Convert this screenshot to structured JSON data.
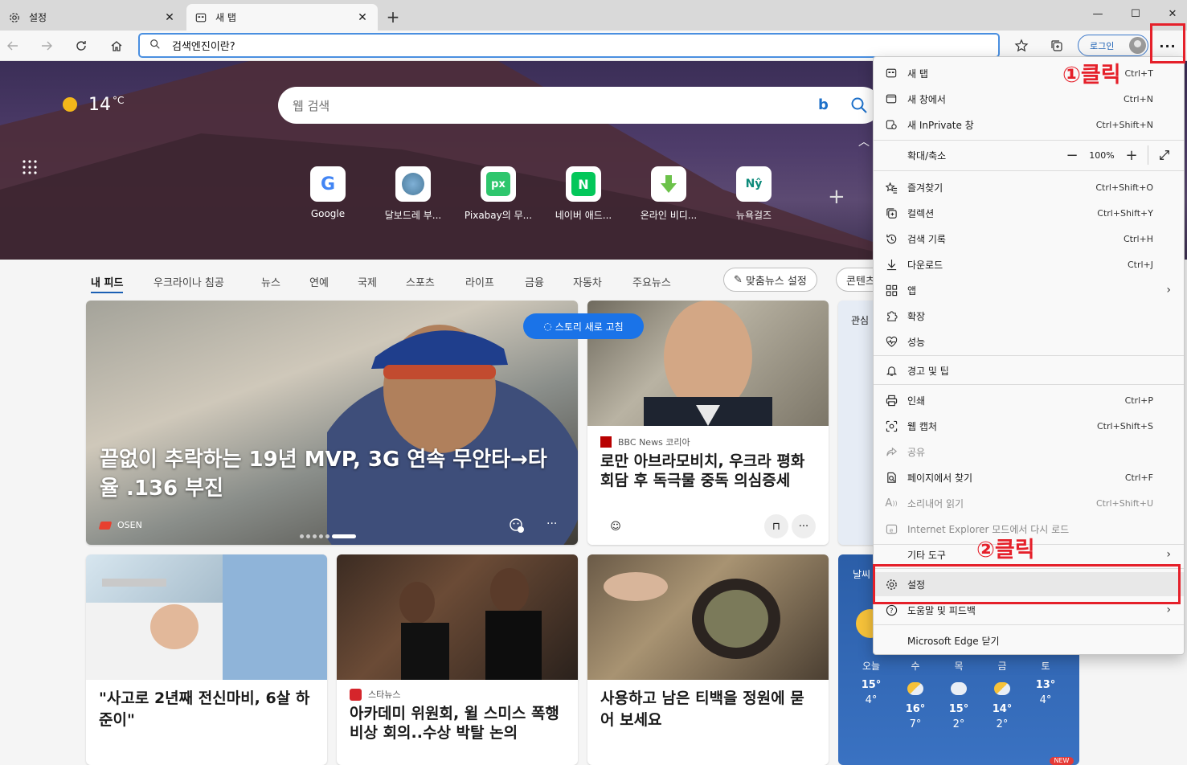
{
  "tabs": [
    {
      "label": "설정",
      "icon": "gear-icon"
    },
    {
      "label": "새 탭",
      "icon": "newtab-page-icon"
    }
  ],
  "address_bar": {
    "value": "검색엔진이란?"
  },
  "toolbar": {
    "login_label": "로그인",
    "more_label": "···"
  },
  "hero": {
    "temperature": "14",
    "temperature_unit": "°C",
    "search_placeholder": "웹 검색",
    "quick_links": [
      {
        "label": "Google",
        "icon": "google-icon"
      },
      {
        "label": "달보드레 부...",
        "icon": "site-avatar-icon"
      },
      {
        "label": "Pixabay의 무...",
        "icon": "pixabay-icon"
      },
      {
        "label": "네이버 애드...",
        "icon": "naver-icon"
      },
      {
        "label": "온라인 비디...",
        "icon": "download-arrow-icon"
      },
      {
        "label": "뉴욕걸즈",
        "icon": "nyg-icon"
      }
    ]
  },
  "feed_nav": {
    "items": [
      "내 피드",
      "우크라이나 침공",
      "뉴스",
      "연예",
      "국제",
      "스포츠",
      "라이프",
      "금융",
      "자동차",
      "주요뉴스"
    ],
    "personalize_label": "맞춤뉴스 설정",
    "content_label": "콘텐츠"
  },
  "cards": {
    "refresh_label": "스토리 새로 고침",
    "big": {
      "headline": "끝없이 추락하는 19년 MVP, 3G 연속 무안타→타율 .136 부진",
      "source": "OSEN"
    },
    "bbc": {
      "source": "BBC News 코리아",
      "title": "로만 아브라모비치, 우크라 평화회담 후 독극물 중독 의심증세"
    },
    "interest": {
      "header": "관심"
    },
    "child": {
      "title": "\"사고로 2년째 전신마비, 6살 하준이\""
    },
    "academy": {
      "source": "스타뉴스",
      "title": "아카데미 위원회, 윌 스미스 폭행 비상 회의..수상 박탈 논의"
    },
    "teabag": {
      "title": "사용하고 남은 티백을 정원에 묻어 보세요"
    }
  },
  "weather": {
    "header": "날씨",
    "days": [
      {
        "day": "오늘",
        "hi": "15°",
        "lo": "4°",
        "icon": "sun"
      },
      {
        "day": "수",
        "hi": "16°",
        "lo": "7°",
        "icon": "ps"
      },
      {
        "day": "목",
        "hi": "15°",
        "lo": "2°",
        "icon": "cloud"
      },
      {
        "day": "금",
        "hi": "14°",
        "lo": "2°",
        "icon": "ps"
      },
      {
        "day": "토",
        "hi": "13°",
        "lo": "4°",
        "icon": "sun"
      }
    ]
  },
  "menu": {
    "items": [
      {
        "label": "새 탭",
        "shortcut": "Ctrl+T",
        "icon": "new-tab-icon"
      },
      {
        "label": "새 창에서",
        "shortcut": "Ctrl+N",
        "icon": "new-window-icon"
      },
      {
        "label": "새 InPrivate 창",
        "shortcut": "Ctrl+Shift+N",
        "icon": "inprivate-icon"
      },
      {
        "label": "즐겨찾기",
        "shortcut": "Ctrl+Shift+O",
        "icon": "favorites-icon"
      },
      {
        "label": "컬렉션",
        "shortcut": "Ctrl+Shift+Y",
        "icon": "collections-icon"
      },
      {
        "label": "검색 기록",
        "shortcut": "Ctrl+H",
        "icon": "history-icon"
      },
      {
        "label": "다운로드",
        "shortcut": "Ctrl+J",
        "icon": "download-icon"
      },
      {
        "label": "앱",
        "shortcut": "",
        "icon": "apps-icon",
        "arrow": true
      },
      {
        "label": "확장",
        "shortcut": "",
        "icon": "extensions-icon"
      },
      {
        "label": "성능",
        "shortcut": "",
        "icon": "performance-icon"
      },
      {
        "label": "경고 및 팁",
        "shortcut": "",
        "icon": "bell-icon"
      },
      {
        "label": "인쇄",
        "shortcut": "Ctrl+P",
        "icon": "print-icon"
      },
      {
        "label": "웹 캡처",
        "shortcut": "Ctrl+Shift+S",
        "icon": "web-capture-icon"
      },
      {
        "label": "공유",
        "shortcut": "",
        "icon": "share-icon",
        "disabled": true
      },
      {
        "label": "페이지에서 찾기",
        "shortcut": "Ctrl+F",
        "icon": "find-icon"
      },
      {
        "label": "소리내어 읽기",
        "shortcut": "Ctrl+Shift+U",
        "icon": "read-aloud-icon",
        "disabled": true
      },
      {
        "label": "Internet Explorer 모드에서 다시 로드",
        "shortcut": "",
        "icon": "ie-mode-icon",
        "disabled": true
      },
      {
        "label": "기타 도구",
        "shortcut": "",
        "icon": "",
        "arrow": true
      },
      {
        "label": "설정",
        "shortcut": "",
        "icon": "gear-icon"
      },
      {
        "label": "도움말 및 피드백",
        "shortcut": "",
        "icon": "help-icon",
        "arrow": true
      },
      {
        "label": "Microsoft Edge 닫기",
        "shortcut": "",
        "icon": ""
      }
    ],
    "zoom": {
      "label": "확대/축소",
      "value": "100%"
    }
  },
  "annotations": {
    "first": "①클릭",
    "second": "②클릭",
    "color": "#e5202a"
  }
}
